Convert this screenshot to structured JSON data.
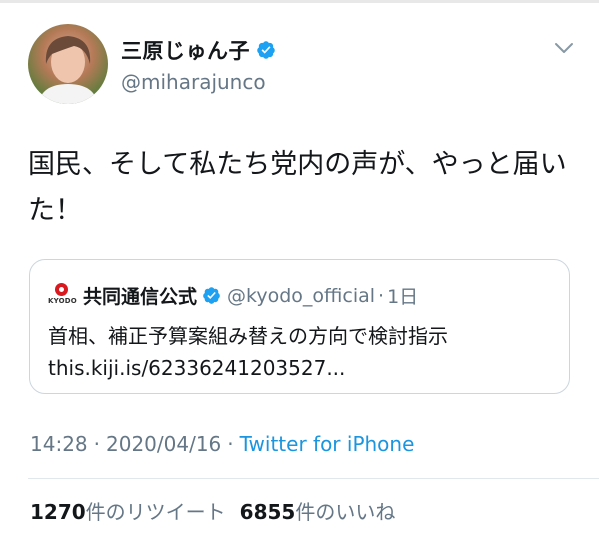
{
  "author": {
    "display_name": "三原じゅん子",
    "handle": "@miharajunco",
    "verified": true
  },
  "tweet": {
    "text": "国民、そして私たち党内の声が、やっと届いた！"
  },
  "quoted_tweet": {
    "logo_text": "KYODO",
    "display_name": "共同通信公式",
    "handle": "@kyodo_official",
    "dot": "·",
    "age": "1日",
    "text": "首相、補正予算案組み替えの方向で検討指示",
    "link": "this.kiji.is/62336241203527..."
  },
  "meta": {
    "time": "14:28",
    "sep1": "·",
    "date": "2020/04/16",
    "sep2": "·",
    "source": "Twitter for iPhone"
  },
  "stats": {
    "retweets_count": "1270",
    "retweets_label": "件のリツイート",
    "likes_count": "6855",
    "likes_label": "件のいいね"
  },
  "colors": {
    "accent": "#1b95e0",
    "verified": "#1da1f2",
    "secondary_text": "#657786",
    "border": "#ccd6dd"
  },
  "icons": [
    "verified-icon",
    "chevron-down-icon",
    "kyodo-logo"
  ]
}
